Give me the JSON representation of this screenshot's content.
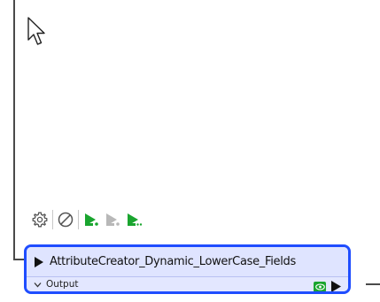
{
  "transformer": {
    "name": "AttributeCreator_Dynamic_LowerCase_Fields",
    "output_port_label": "Output"
  },
  "toolbar": {
    "icons": [
      "gear-icon",
      "disable-icon",
      "run-to-this-icon",
      "run-from-this-icon",
      "run-just-this-icon"
    ]
  },
  "colors": {
    "selection_border": "#1f4dff",
    "transformer_fill": "#dde2ff",
    "run_green": "#1aa52f",
    "run_disabled": "#b8b8b8"
  }
}
